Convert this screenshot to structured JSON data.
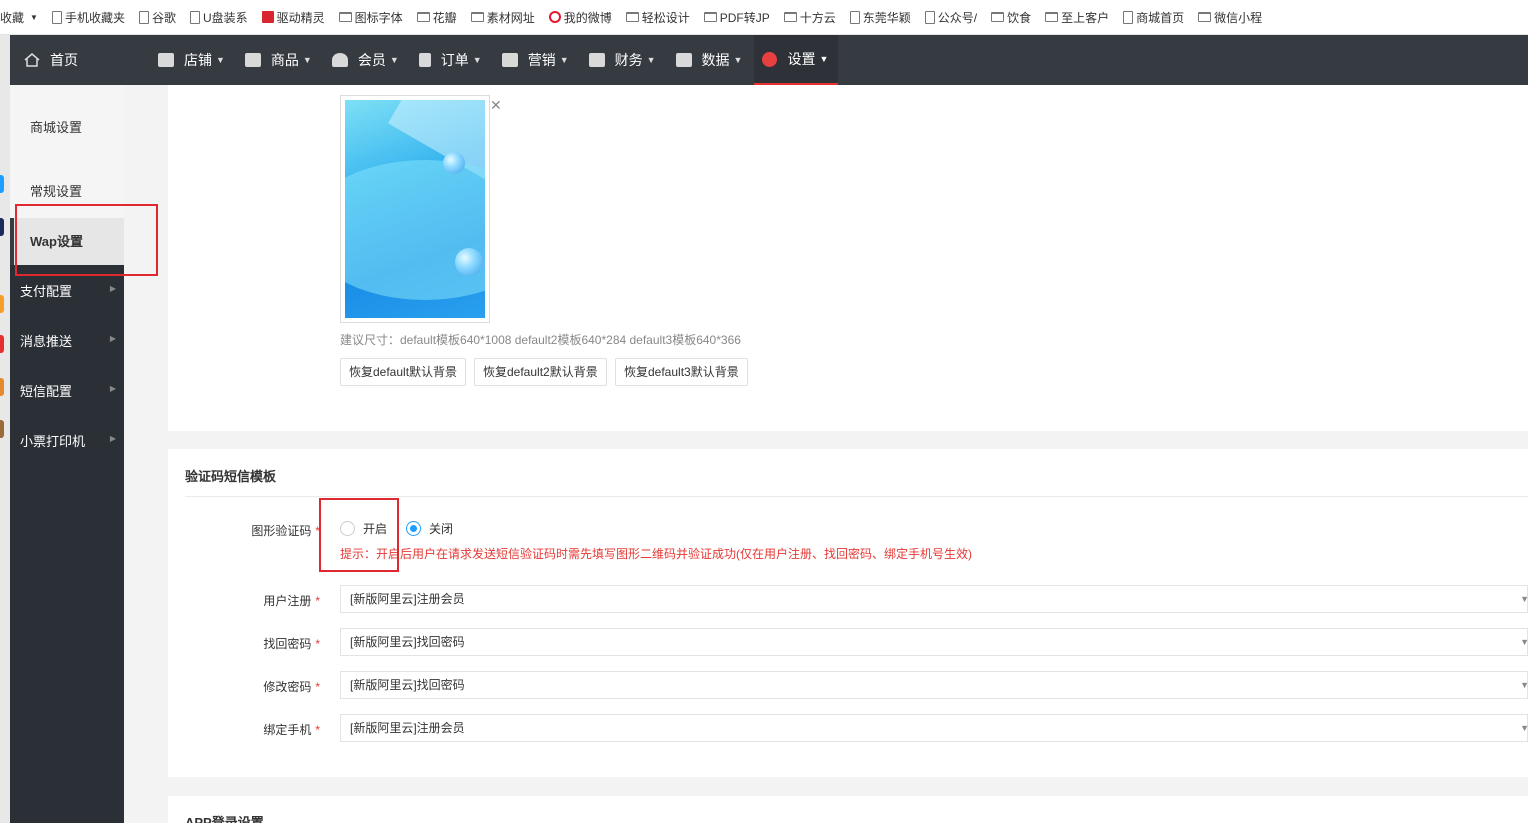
{
  "bookmarks": [
    {
      "label": "收藏",
      "icon": "dropdown"
    },
    {
      "label": "手机收藏夹",
      "icon": "page-icon"
    },
    {
      "label": "谷歌",
      "icon": "page-icon"
    },
    {
      "label": "U盘装系",
      "icon": "page-icon"
    },
    {
      "label": "驱动精灵",
      "icon": "driver-icon"
    },
    {
      "label": "图标字体",
      "icon": "folder-icon"
    },
    {
      "label": "花瓣",
      "icon": "folder-icon"
    },
    {
      "label": "素材网址",
      "icon": "folder-icon"
    },
    {
      "label": "我的微博",
      "icon": "weibo-icon"
    },
    {
      "label": "轻松设计",
      "icon": "folder-icon"
    },
    {
      "label": "PDF转JP",
      "icon": "folder-icon"
    },
    {
      "label": "十方云",
      "icon": "folder-icon"
    },
    {
      "label": "东莞华颖",
      "icon": "page-icon"
    },
    {
      "label": "公众号/",
      "icon": "page-icon"
    },
    {
      "label": "饮食",
      "icon": "folder-icon"
    },
    {
      "label": "至上客户",
      "icon": "folder-icon"
    },
    {
      "label": "商城首页",
      "icon": "page-icon"
    },
    {
      "label": "微信小程",
      "icon": "folder-icon"
    }
  ],
  "topnav": {
    "home": "首页",
    "items": [
      {
        "label": "店铺",
        "icon": "shop-icon"
      },
      {
        "label": "商品",
        "icon": "goods-icon"
      },
      {
        "label": "会员",
        "icon": "member-icon"
      },
      {
        "label": "订单",
        "icon": "order-icon"
      },
      {
        "label": "营销",
        "icon": "gift-icon"
      },
      {
        "label": "财务",
        "icon": "money-icon"
      },
      {
        "label": "数据",
        "icon": "chart-icon"
      },
      {
        "label": "设置",
        "icon": "gear-icon",
        "active": true
      }
    ]
  },
  "sidenav": {
    "sub_items": [
      "商城设置",
      "常规设置",
      "Wap设置"
    ],
    "items": [
      "支付配置",
      "消息推送",
      "短信配置",
      "小票打印机"
    ]
  },
  "background_section": {
    "hint": "建议尺寸：default模板640*1008 default2模板640*284 default3模板640*366",
    "buttons": [
      "恢复default默认背景",
      "恢复default2默认背景",
      "恢复default3默认背景"
    ]
  },
  "sms_section": {
    "title": "验证码短信模板",
    "captcha_label": "图形验证码",
    "captcha_on": "开启",
    "captcha_off": "关闭",
    "captcha_tip": "提示：开启后用户在请求发送短信验证码时需先填写图形二维码并验证成功(仅在用户注册、找回密码、绑定手机号生效)",
    "rows": [
      {
        "label": "用户注册",
        "value": "[新版阿里云]注册会员"
      },
      {
        "label": "找回密码",
        "value": "[新版阿里云]找回密码"
      },
      {
        "label": "修改密码",
        "value": "[新版阿里云]找回密码"
      },
      {
        "label": "绑定手机",
        "value": "[新版阿里云]注册会员"
      }
    ],
    "required_mark": "*"
  },
  "app_section": {
    "title": "APP登录设置"
  },
  "colors": {
    "nav_bg": "#363a41",
    "accent": "#1e9fff",
    "danger": "#e53935"
  }
}
